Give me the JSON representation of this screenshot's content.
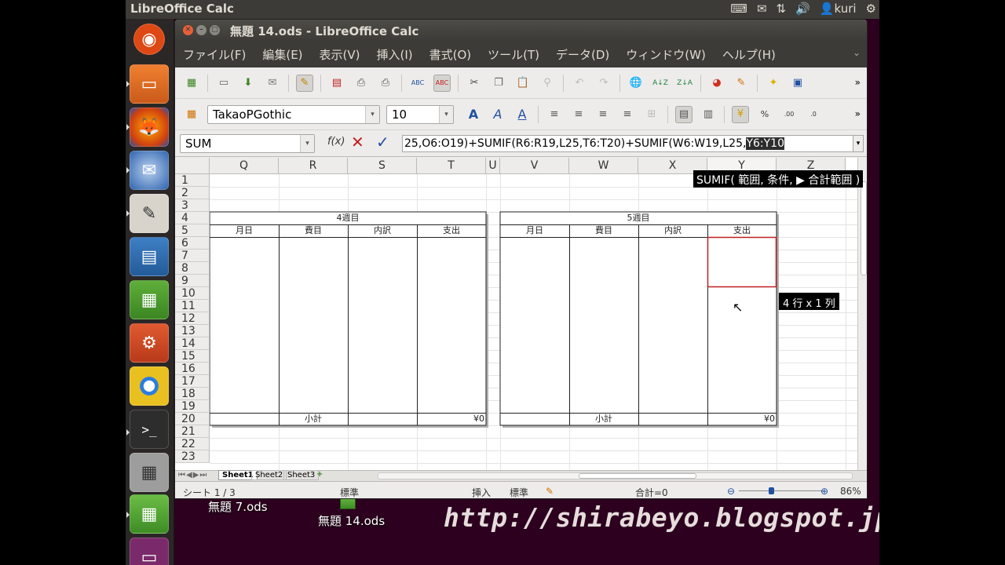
{
  "top_panel": {
    "app_title": "LibreOffice Calc",
    "user": "kuri"
  },
  "desktop": {
    "icon1_label": "無題 7.ods",
    "icon2_label": "無題 14.ods",
    "watermark": "http://shirabeyo.blogspot.jp/"
  },
  "window": {
    "title": "無題 14.ods - LibreOffice Calc"
  },
  "menu": [
    "ファイル(F)",
    "編集(E)",
    "表示(V)",
    "挿入(I)",
    "書式(O)",
    "ツール(T)",
    "データ(D)",
    "ウィンドウ(W)",
    "ヘルプ(H)"
  ],
  "formatting": {
    "font_name": "TakaoPGothic",
    "font_size": "10"
  },
  "formula_bar": {
    "name_box": "SUM",
    "formula_prefix": "25,O6:O19)+SUMIF(R6:R19,L25,T6:T20)+SUMIF(W6:W19,L25,",
    "formula_selected": "Y6:Y10",
    "tooltip": "SUMIF( 範囲, 条件, ▶ 合計範囲 )"
  },
  "grid": {
    "columns": [
      "Q",
      "R",
      "S",
      "T",
      "U",
      "V",
      "W",
      "X",
      "Y",
      "Z"
    ],
    "rows": [
      "1",
      "2",
      "3",
      "4",
      "5",
      "6",
      "7",
      "8",
      "9",
      "10",
      "11",
      "12",
      "13",
      "14",
      "15",
      "16",
      "17",
      "18",
      "19",
      "20",
      "21",
      "22",
      "23"
    ],
    "block4": {
      "title": "4週目",
      "headers": [
        "月日",
        "費目",
        "内訳",
        "支出"
      ],
      "subtotal_label": "小計",
      "subtotal_value": "¥0"
    },
    "block5": {
      "title": "5週目",
      "headers": [
        "月日",
        "費目",
        "内訳",
        "支出"
      ],
      "subtotal_label": "小計",
      "subtotal_value": "¥0"
    },
    "selection_tip": "4 行 x 1 列"
  },
  "sheet_tabs": [
    "Sheet1",
    "Sheet2",
    "Sheet3"
  ],
  "status_bar": {
    "sheet": "シート 1 / 3",
    "style": "標準",
    "insert_mode": "挿入",
    "selection_mode": "標準",
    "sum": "合計=0",
    "zoom": "86%"
  }
}
